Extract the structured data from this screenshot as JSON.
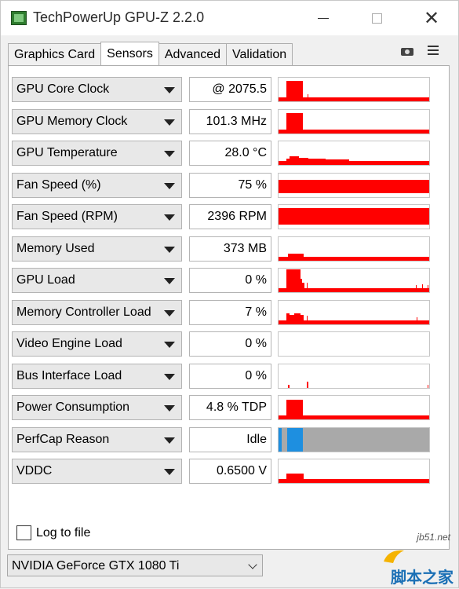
{
  "window": {
    "title": "TechPowerUp GPU-Z 2.2.0"
  },
  "tabs": [
    {
      "label": "Graphics Card",
      "active": false
    },
    {
      "label": "Sensors",
      "active": true
    },
    {
      "label": "Advanced",
      "active": false
    },
    {
      "label": "Validation",
      "active": false
    }
  ],
  "toolbar_icons": [
    "camera-icon",
    "menu-icon"
  ],
  "colors": {
    "graph": "#ff0000",
    "perfcap_gray": "#a9a9a9",
    "perfcap_blue": "#1e8fe0",
    "panel": "#ffffff"
  },
  "sensors": [
    {
      "label": "GPU Core Clock",
      "value": "@ 2075.5"
    },
    {
      "label": "GPU Memory Clock",
      "value": "101.3 MHz"
    },
    {
      "label": "GPU Temperature",
      "value": "28.0 °C"
    },
    {
      "label": "Fan Speed (%)",
      "value": "75 %"
    },
    {
      "label": "Fan Speed (RPM)",
      "value": "2396 RPM"
    },
    {
      "label": "Memory Used",
      "value": "373 MB"
    },
    {
      "label": "GPU Load",
      "value": "0 %"
    },
    {
      "label": "Memory Controller Load",
      "value": "7 %"
    },
    {
      "label": "Video Engine Load",
      "value": "0 %"
    },
    {
      "label": "Bus Interface Load",
      "value": "0 %"
    },
    {
      "label": "Power Consumption",
      "value": "4.8 % TDP"
    },
    {
      "label": "PerfCap Reason",
      "value": "Idle"
    },
    {
      "label": "VDDC",
      "value": "0.6500 V"
    }
  ],
  "log_to_file": {
    "label": "Log to file",
    "checked": false
  },
  "gpu_select": {
    "value": "NVIDIA GeForce GTX 1080 Ti"
  },
  "watermark": {
    "site": "jb51.net",
    "name": "脚本之家"
  }
}
